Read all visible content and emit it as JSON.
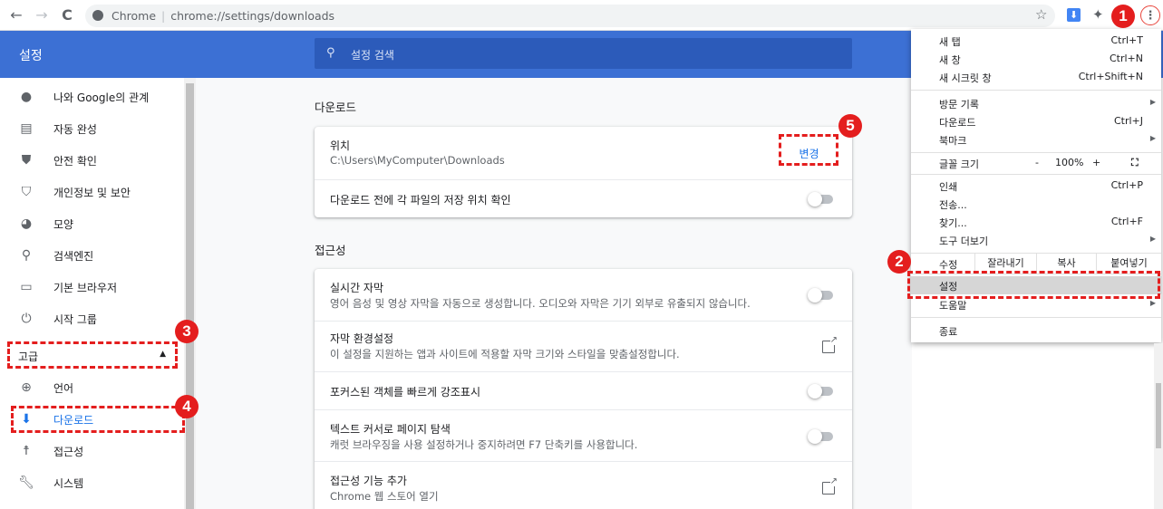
{
  "browser": {
    "back": "←",
    "forward": "→",
    "reload": "C",
    "site_name": "Chrome",
    "url": "chrome://settings/downloads"
  },
  "header": {
    "title": "설정",
    "search_placeholder": "설정 검색"
  },
  "sidebar": {
    "items": [
      {
        "label": "나와 Google의 관계",
        "icon": "person-icon"
      },
      {
        "label": "자동 완성",
        "icon": "clipboard-icon"
      },
      {
        "label": "안전 확인",
        "icon": "shield-check-icon"
      },
      {
        "label": "개인정보 및 보안",
        "icon": "shield-icon"
      },
      {
        "label": "모양",
        "icon": "palette-icon"
      },
      {
        "label": "검색엔진",
        "icon": "search-icon"
      },
      {
        "label": "기본 브라우저",
        "icon": "browser-icon"
      },
      {
        "label": "시작 그룹",
        "icon": "power-icon"
      }
    ],
    "advanced_label": "고급",
    "advanced_items": [
      {
        "label": "언어",
        "icon": "globe-icon"
      },
      {
        "label": "다운로드",
        "icon": "download-icon"
      },
      {
        "label": "접근성",
        "icon": "accessibility-icon"
      },
      {
        "label": "시스템",
        "icon": "wrench-icon"
      }
    ]
  },
  "downloads": {
    "section_title": "다운로드",
    "location_title": "위치",
    "location_path": "C:\\Users\\MyComputer\\Downloads",
    "change_label": "변경",
    "ask_title": "다운로드 전에 각 파일의 저장 위치 확인"
  },
  "accessibility": {
    "section_title": "접근성",
    "live_caption_title": "실시간 자막",
    "live_caption_sub": "영어 음성 및 영상 자막을 자동으로 생성합니다. 오디오와 자막은 기기 외부로 유출되지 않습니다.",
    "caption_pref_title": "자막 환경설정",
    "caption_pref_sub": "이 설정을 지원하는 앱과 사이트에 적용할 자막 크기와 스타일을 맞춤설정합니다.",
    "focus_title": "포커스된 객체를 빠르게 강조표시",
    "caret_title": "텍스트 커서로 페이지 탐색",
    "caret_sub": "캐럿 브라우징을 사용 설정하거나 중지하려면 F7 단축키를 사용합니다.",
    "add_title": "접근성 기능 추가",
    "add_sub": "Chrome 웹 스토어 열기"
  },
  "menu": {
    "new_tab": "새 탭",
    "new_tab_sc": "Ctrl+T",
    "new_window": "새 창",
    "new_window_sc": "Ctrl+N",
    "incognito": "새 시크릿 창",
    "incognito_sc": "Ctrl+Shift+N",
    "history": "방문 기록",
    "downloads": "다운로드",
    "downloads_sc": "Ctrl+J",
    "bookmarks": "북마크",
    "zoom": "글꼴 크기",
    "zoom_minus": "-",
    "zoom_value": "100%",
    "zoom_plus": "+",
    "print": "인쇄",
    "print_sc": "Ctrl+P",
    "cast": "전송...",
    "find": "찾기...",
    "find_sc": "Ctrl+F",
    "more_tools": "도구 더보기",
    "edit": "수정",
    "cut": "잘라내기",
    "copy": "복사",
    "paste": "붙여넣기",
    "settings": "설정",
    "help": "도움말",
    "exit": "종료"
  },
  "annotations": {
    "b1": "1",
    "b2": "2",
    "b3": "3",
    "b4": "4",
    "b5": "5",
    "color": "#e41e1e"
  }
}
